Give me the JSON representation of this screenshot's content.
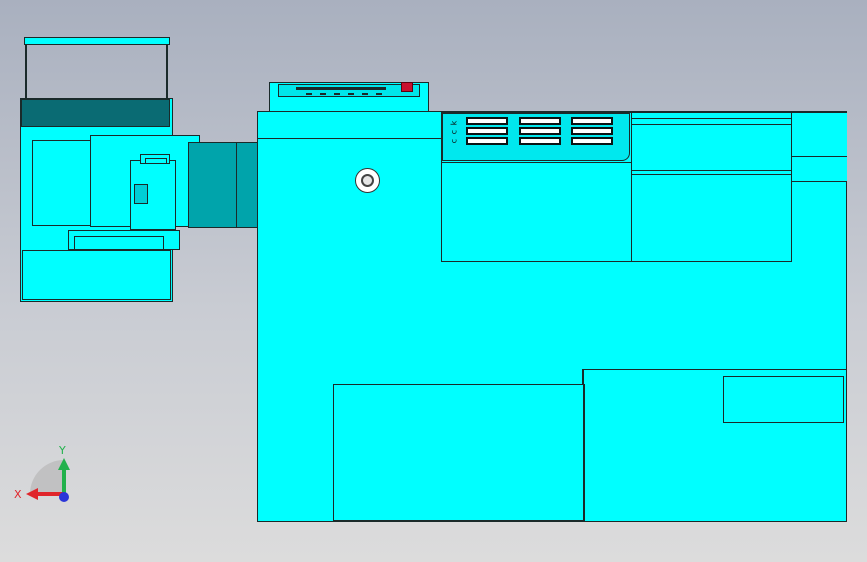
{
  "view": {
    "background_top": "#a9b0bf",
    "background_bottom": "#dcdcdc",
    "model_color": "#00ffff",
    "edge_color": "#1a2a2a"
  },
  "triad": {
    "x_label": "X",
    "y_label": "Y",
    "x_color": "#e0252b",
    "y_color": "#22b14c",
    "z_color": "#2a35d8"
  }
}
